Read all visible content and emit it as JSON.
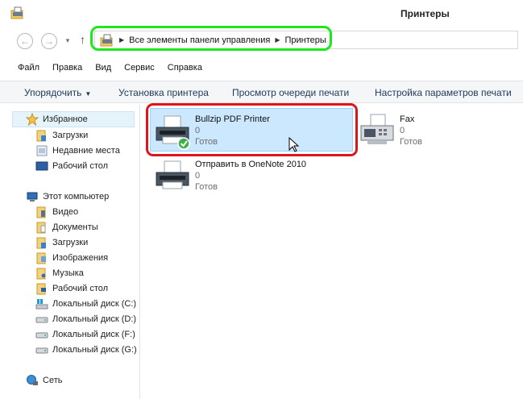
{
  "window": {
    "title": "Принтеры"
  },
  "address": {
    "crumbs": [
      "Все элементы панели управления",
      "Принтеры"
    ],
    "back_icon": "arrow-left-icon",
    "forward_icon": "arrow-right-icon",
    "up_icon": "arrow-up-icon"
  },
  "menu": [
    "Файл",
    "Правка",
    "Вид",
    "Сервис",
    "Справка"
  ],
  "commands": {
    "organize": "Упорядочить",
    "install": "Установка принтера",
    "queue": "Просмотр очереди печати",
    "settings": "Настройка параметров печати"
  },
  "nav": {
    "favorites": "Избранное",
    "fav_items": [
      "Загрузки",
      "Недавние места",
      "Рабочий стол"
    ],
    "computer": "Этот компьютер",
    "comp_items": [
      "Видео",
      "Документы",
      "Загрузки",
      "Изображения",
      "Музыка",
      "Рабочий стол"
    ],
    "drives": [
      "Локальный диск (C:)",
      "Локальный диск (D:)",
      "Локальный диск (F:)",
      "Локальный диск (G:)"
    ],
    "network": "Сеть"
  },
  "printers": [
    {
      "name": "Bullzip PDF Printer",
      "jobs": "0",
      "status": "Готов",
      "default": true,
      "selected": true
    },
    {
      "name": "Fax",
      "jobs": "0",
      "status": "Готов",
      "default": false,
      "selected": false
    },
    {
      "name": "Отправить в OneNote 2010",
      "jobs": "0",
      "status": "Готов",
      "default": false,
      "selected": false
    }
  ],
  "colors": {
    "highlight_green": "#1ce81c",
    "highlight_red": "#e0141b",
    "selection": "#cce8ff"
  }
}
